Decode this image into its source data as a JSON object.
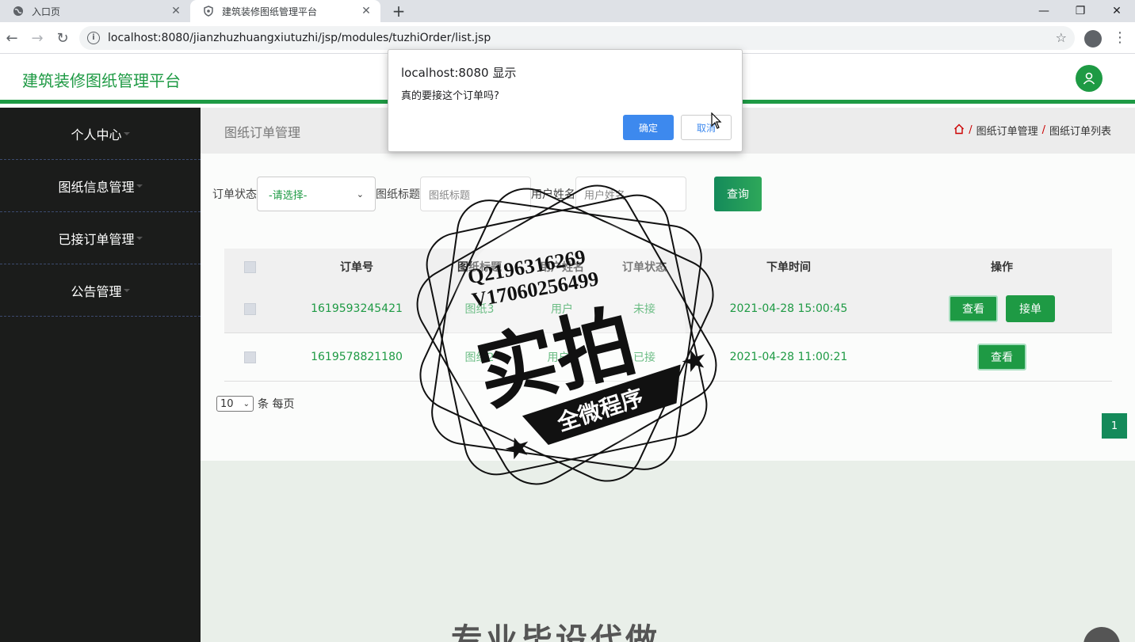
{
  "browser": {
    "tabs": [
      {
        "title": "入口页",
        "active": false
      },
      {
        "title": "建筑装修图纸管理平台",
        "active": true
      }
    ],
    "url": "localhost:8080/jianzhuzhuangxiutuzhi/jsp/modules/tuzhiOrder/list.jsp"
  },
  "app": {
    "brand": "建筑装修图纸管理平台",
    "accent": "#1e9a44"
  },
  "sidebar": {
    "items": [
      {
        "label": "个人中心"
      },
      {
        "label": "图纸信息管理"
      },
      {
        "label": "已接订单管理"
      },
      {
        "label": "公告管理"
      }
    ]
  },
  "page": {
    "title": "图纸订单管理",
    "breadcrumb": [
      "图纸订单管理",
      "图纸订单列表"
    ]
  },
  "search": {
    "status_label": "订单状态",
    "status_value": "-请选择-",
    "title_label": "图纸标题",
    "title_placeholder": "图纸标题",
    "user_label": "用户姓名",
    "user_placeholder": "用户姓名",
    "query_button": "查询"
  },
  "table": {
    "headers": [
      "订单号",
      "图纸标题",
      "用户姓名",
      "订单状态",
      "下单时间",
      "操作"
    ],
    "rows": [
      {
        "order_no": "1619593245421",
        "title": "图纸3",
        "user": "用户",
        "status": "未接",
        "time": "2021-04-28 15:00:45",
        "actions": [
          "查看",
          "接单"
        ]
      },
      {
        "order_no": "1619578821180",
        "title": "图纸2",
        "user": "用户1",
        "status": "已接",
        "time": "2021-04-28 11:00:21",
        "actions": [
          "查看"
        ]
      }
    ]
  },
  "pagination": {
    "page_size": "10",
    "page_size_suffix": "条 每页",
    "current_page": "1"
  },
  "dialog": {
    "title": "localhost:8080 显示",
    "message": "真的要接这个订单吗?",
    "ok": "确定",
    "cancel": "取消"
  },
  "watermark": {
    "line1": "Q2196316269",
    "line2": "V17060256499",
    "main": "实拍",
    "banner": "全微程序"
  },
  "footer": {
    "partial_text": "专业毕设代做"
  }
}
